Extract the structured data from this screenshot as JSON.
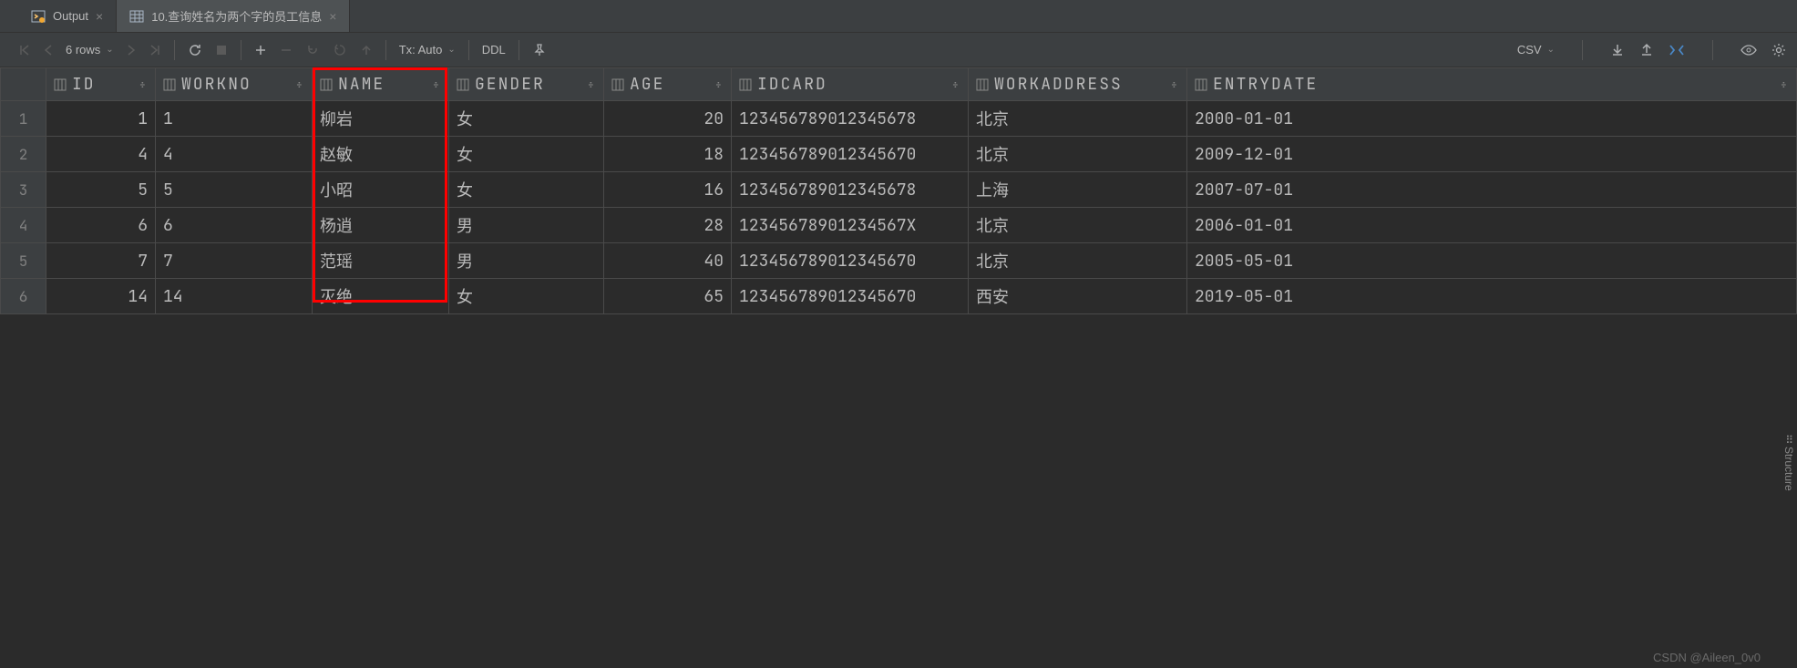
{
  "tabs": [
    {
      "label": "Output",
      "icon": "output-icon"
    },
    {
      "label": "10.查询姓名为两个字的员工信息",
      "icon": "table-icon"
    }
  ],
  "toolbar": {
    "rows_label": "6 rows",
    "tx_label": "Tx: Auto",
    "ddl_label": "DDL",
    "csv_label": "CSV"
  },
  "columns": [
    "ID",
    "WORKNO",
    "NAME",
    "GENDER",
    "AGE",
    "IDCARD",
    "WORKADDRESS",
    "ENTRYDATE"
  ],
  "rows": [
    {
      "n": "1",
      "id": "1",
      "workno": "1",
      "name": "柳岩",
      "gender": "女",
      "age": "20",
      "idcard": "123456789012345678",
      "workaddress": "北京",
      "entrydate": "2000-01-01"
    },
    {
      "n": "2",
      "id": "4",
      "workno": "4",
      "name": "赵敏",
      "gender": "女",
      "age": "18",
      "idcard": "123456789012345670",
      "workaddress": "北京",
      "entrydate": "2009-12-01"
    },
    {
      "n": "3",
      "id": "5",
      "workno": "5",
      "name": "小昭",
      "gender": "女",
      "age": "16",
      "idcard": "123456789012345678",
      "workaddress": "上海",
      "entrydate": "2007-07-01"
    },
    {
      "n": "4",
      "id": "6",
      "workno": "6",
      "name": "杨逍",
      "gender": "男",
      "age": "28",
      "idcard": "12345678901234567X",
      "workaddress": "北京",
      "entrydate": "2006-01-01"
    },
    {
      "n": "5",
      "id": "7",
      "workno": "7",
      "name": "范瑶",
      "gender": "男",
      "age": "40",
      "idcard": "123456789012345670",
      "workaddress": "北京",
      "entrydate": "2005-05-01"
    },
    {
      "n": "6",
      "id": "14",
      "workno": "14",
      "name": "灭绝",
      "gender": "女",
      "age": "65",
      "idcard": "123456789012345670",
      "workaddress": "西安",
      "entrydate": "2019-05-01"
    }
  ],
  "side_label": "Structure",
  "watermark": "CSDN @Aileen_0v0"
}
